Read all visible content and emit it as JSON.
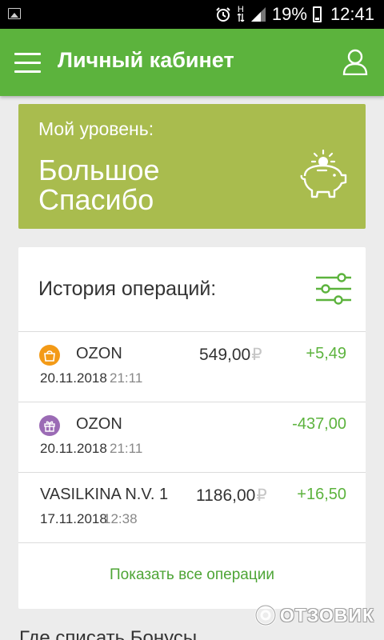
{
  "statusbar": {
    "network_letter": "H",
    "battery_percent": "19%",
    "time": "12:41",
    "icons": [
      "gallery-icon",
      "alarm-icon",
      "data-arrows-icon",
      "signal-icon",
      "battery-icon"
    ]
  },
  "appbar": {
    "title": "Личный кабинет",
    "color": "#5cb33d",
    "icons": [
      "menu-icon",
      "profile-icon"
    ]
  },
  "level": {
    "label": "Мой уровень:",
    "name": "Большое Спасибо",
    "color": "#a9bc4e",
    "icon": "piggy-bank-icon"
  },
  "history": {
    "title": "История операций:",
    "filter_icon": "filter-sliders-icon",
    "operations": [
      {
        "name": "OZON",
        "date": "20.11.2018",
        "time": "21:11",
        "amount": "549,00",
        "currency": "₽",
        "bonus": "+5,49",
        "badge_color": "#f39a17",
        "badge_icon": "bag-icon"
      },
      {
        "name": "OZON",
        "date": "20.11.2018",
        "time": "21:11",
        "amount": "",
        "currency": "",
        "bonus": "-437,00",
        "badge_color": "#9b6bb5",
        "badge_icon": "gift-icon"
      },
      {
        "name": "VASILKINA N.V. 1",
        "date": "17.11.2018",
        "time": "12:38",
        "amount": "1186,00",
        "currency": "₽",
        "bonus": "+16,50"
      }
    ],
    "show_all": "Показать все операции"
  },
  "bottom_heading": "Где списать Бонусы",
  "watermark": "ОТЗОВИК",
  "accent_green": "#4ea536"
}
